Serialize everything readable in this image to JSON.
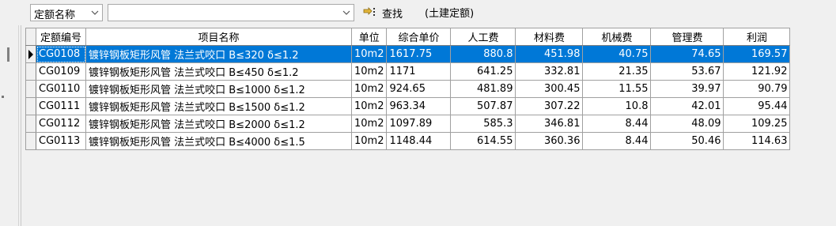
{
  "toolbar": {
    "field_select": "定额名称",
    "search_value": "",
    "find_label": "查找",
    "subtitle": "(土建定额)"
  },
  "grid": {
    "columns": [
      "定额编号",
      "项目名称",
      "单位",
      "综合单价",
      "人工费",
      "材料费",
      "机械费",
      "管理费",
      "利润"
    ],
    "rows": [
      {
        "code": "CG0108",
        "name": "镀锌钢板矩形风管 法兰式咬口 B≤320 δ≤1.2",
        "unit": "10m2",
        "price": "1617.75",
        "labor": "880.8",
        "material": "451.98",
        "machine": "40.75",
        "mgmt": "74.65",
        "profit": "169.57"
      },
      {
        "code": "CG0109",
        "name": "镀锌钢板矩形风管 法兰式咬口 B≤450 δ≤1.2",
        "unit": "10m2",
        "price": "1171",
        "labor": "641.25",
        "material": "332.81",
        "machine": "21.35",
        "mgmt": "53.67",
        "profit": "121.92"
      },
      {
        "code": "CG0110",
        "name": "镀锌钢板矩形风管 法兰式咬口 B≤1000 δ≤1.2",
        "unit": "10m2",
        "price": "924.65",
        "labor": "481.89",
        "material": "300.45",
        "machine": "11.55",
        "mgmt": "39.97",
        "profit": "90.79"
      },
      {
        "code": "CG0111",
        "name": "镀锌钢板矩形风管 法兰式咬口 B≤1500 δ≤1.2",
        "unit": "10m2",
        "price": "963.34",
        "labor": "507.87",
        "material": "307.22",
        "machine": "10.8",
        "mgmt": "42.01",
        "profit": "95.44"
      },
      {
        "code": "CG0112",
        "name": "镀锌钢板矩形风管 法兰式咬口 B≤2000 δ≤1.2",
        "unit": "10m2",
        "price": "1097.89",
        "labor": "585.3",
        "material": "346.81",
        "machine": "8.44",
        "mgmt": "48.09",
        "profit": "109.25"
      },
      {
        "code": "CG0113",
        "name": "镀锌钢板矩形风管 法兰式咬口 B≤4000 δ≤1.5",
        "unit": "10m2",
        "price": "1148.44",
        "labor": "614.55",
        "material": "360.36",
        "machine": "8.44",
        "mgmt": "50.46",
        "profit": "114.63"
      }
    ],
    "selected_row": 0
  },
  "colors": {
    "selection": "#0078d7",
    "background": "#f0f0f0"
  }
}
